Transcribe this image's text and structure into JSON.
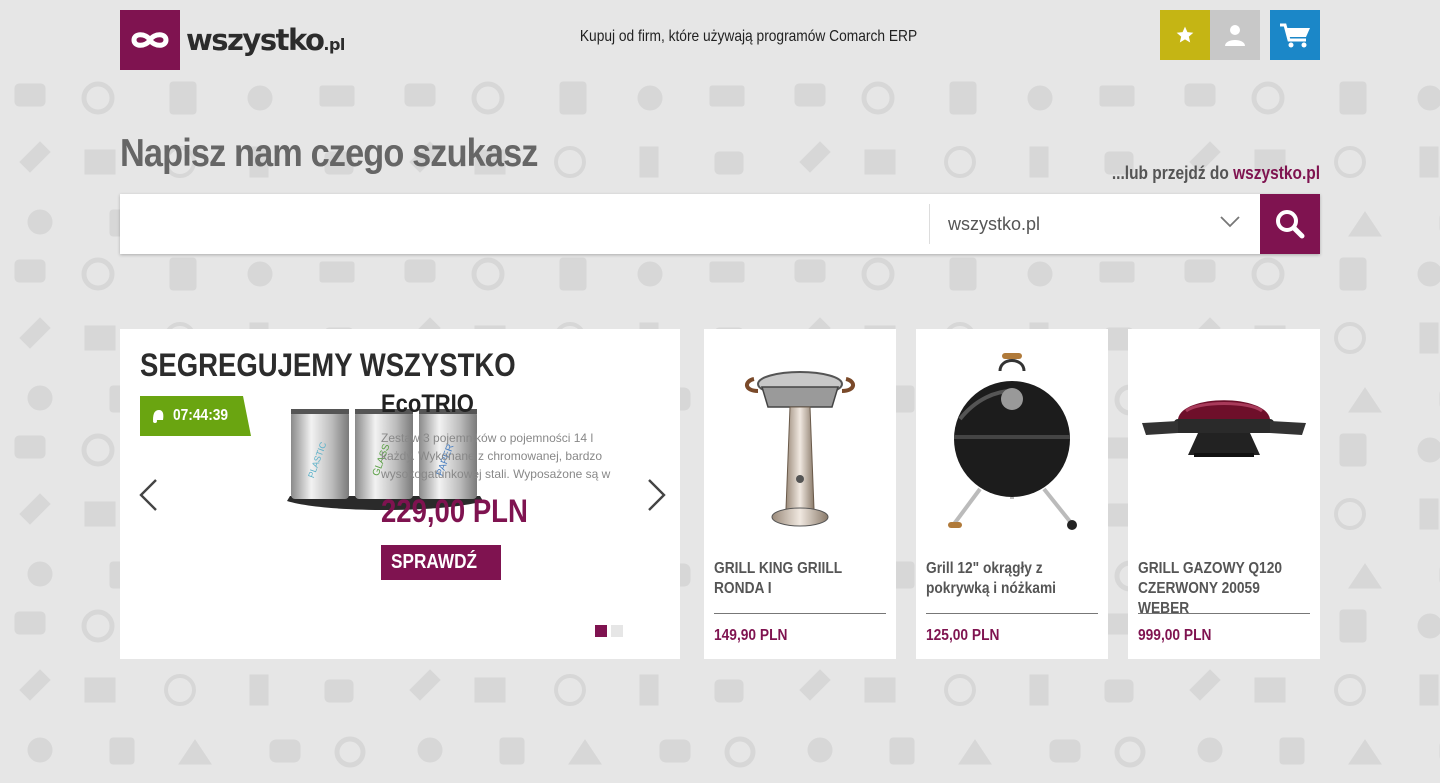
{
  "brand": {
    "name": "wszystko",
    "tld": ".pl",
    "color": "#7f1350"
  },
  "header": {
    "tagline": "Kupuj od firm, które używają programów Comarch ERP",
    "favorites_icon": "star-icon",
    "account_icon": "user-icon",
    "cart_icon": "cart-icon",
    "favorites_color": "#c5b514",
    "cart_color": "#1b87c8"
  },
  "search": {
    "title": "Napisz nam czego szukasz",
    "or_go_prefix": "...lub przejdź do ",
    "or_go_link": "wszystko.pl",
    "input_value": "",
    "placeholder": "",
    "selected_store": "wszystko.pl",
    "search_icon": "search-icon"
  },
  "promo": {
    "heading": "SEGREGUJEMY WSZYSTKO",
    "timer": "07:44:39",
    "timer_color": "#6aa511",
    "product_name": "EcoTRIO",
    "description": "Zestaw 3 pojemników o pojemności 14 l każdy. Wykonane z chromowanej, bardzo wysokogatunkowej stali. Wyposażone są w",
    "price": "229,00 PLN",
    "button": "SPRAWDŹ",
    "bin_labels": [
      "PLASTIC",
      "GLASS",
      "PAPER"
    ],
    "slides_total": 2,
    "active_slide": 1
  },
  "products": [
    {
      "name": "GRILL KING GRIILL RONDA I",
      "price": "149,90 PLN"
    },
    {
      "name": "Grill 12\" okrągły z pokrywką i nóżkami",
      "price": "125,00 PLN"
    },
    {
      "name": "GRILL GAZOWY Q120 CZERWONY 20059 WEBER",
      "price": "999,00 PLN"
    }
  ]
}
